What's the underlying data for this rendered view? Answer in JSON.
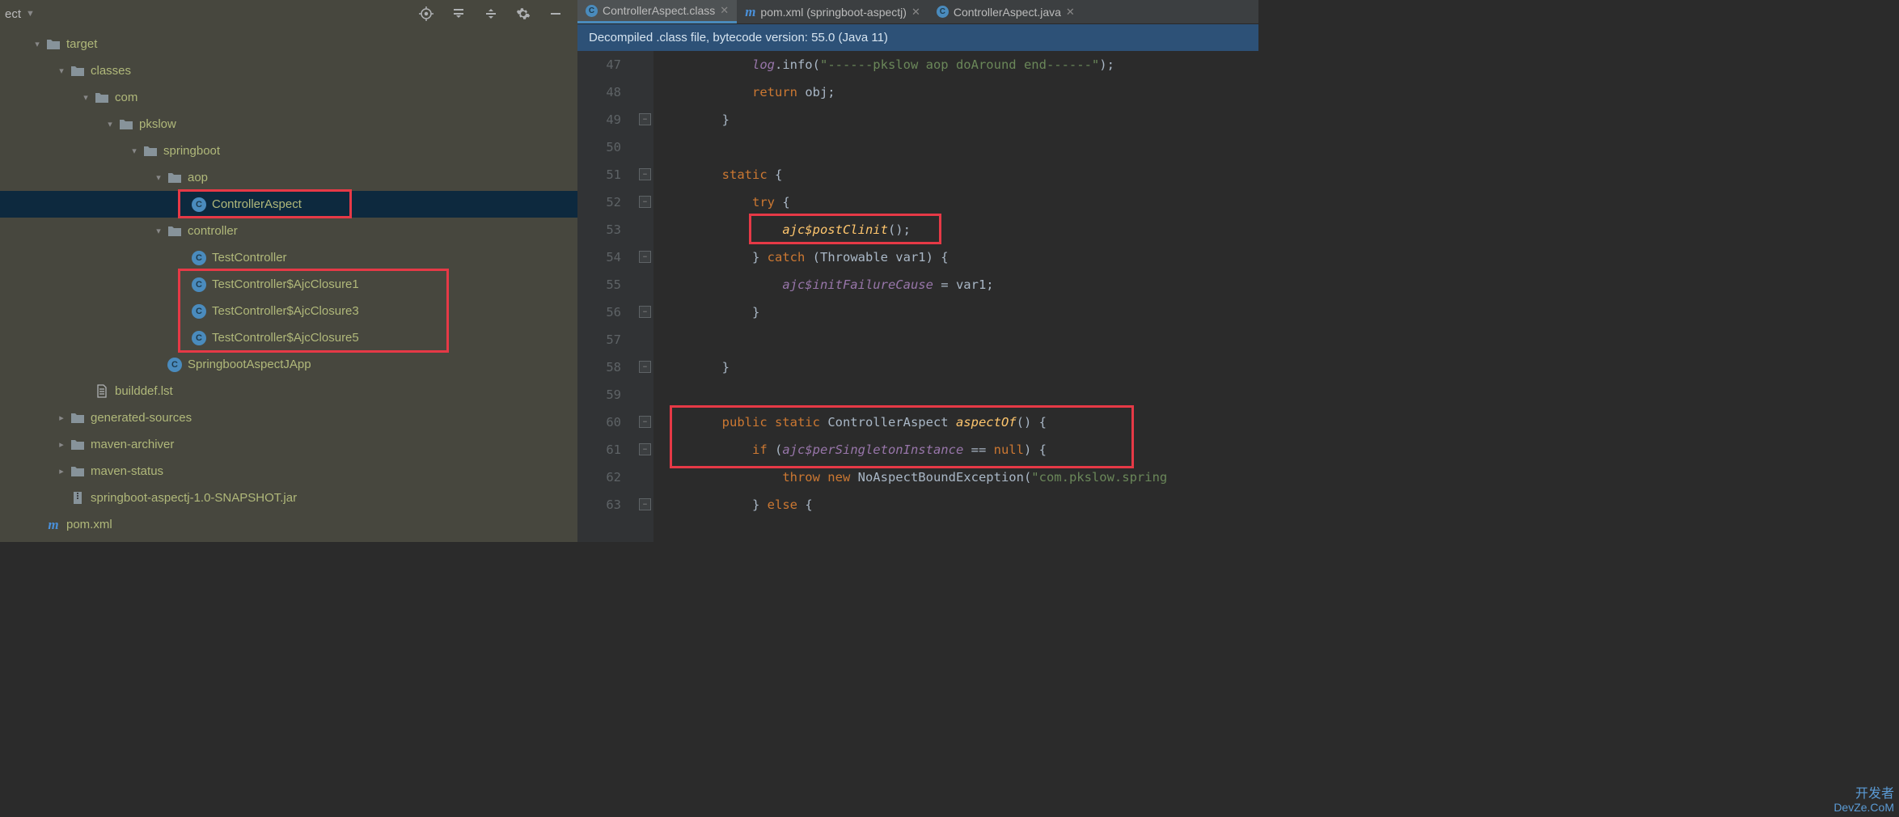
{
  "sidebar": {
    "title": "ect",
    "tree": [
      {
        "indent": 1,
        "arrow": "▾",
        "icon": "folder",
        "label": "target"
      },
      {
        "indent": 2,
        "arrow": "▾",
        "icon": "folder",
        "label": "classes"
      },
      {
        "indent": 3,
        "arrow": "▾",
        "icon": "folder",
        "label": "com"
      },
      {
        "indent": 4,
        "arrow": "▾",
        "icon": "folder",
        "label": "pkslow"
      },
      {
        "indent": 5,
        "arrow": "▾",
        "icon": "folder",
        "label": "springboot"
      },
      {
        "indent": 6,
        "arrow": "▾",
        "icon": "folder",
        "label": "aop"
      },
      {
        "indent": 7,
        "arrow": "",
        "icon": "class",
        "label": "ControllerAspect",
        "selected": true
      },
      {
        "indent": 6,
        "arrow": "▾",
        "icon": "folder",
        "label": "controller"
      },
      {
        "indent": 7,
        "arrow": "",
        "icon": "class",
        "label": "TestController"
      },
      {
        "indent": 7,
        "arrow": "",
        "icon": "class",
        "label": "TestController$AjcClosure1"
      },
      {
        "indent": 7,
        "arrow": "",
        "icon": "class",
        "label": "TestController$AjcClosure3"
      },
      {
        "indent": 7,
        "arrow": "",
        "icon": "class",
        "label": "TestController$AjcClosure5"
      },
      {
        "indent": 6,
        "arrow": "",
        "icon": "class",
        "label": "SpringbootAspectJApp"
      },
      {
        "indent": 3,
        "arrow": "",
        "icon": "file",
        "label": "builddef.lst"
      },
      {
        "indent": 2,
        "arrow": "▸",
        "icon": "folder",
        "label": "generated-sources"
      },
      {
        "indent": 2,
        "arrow": "▸",
        "icon": "folder",
        "label": "maven-archiver"
      },
      {
        "indent": 2,
        "arrow": "▸",
        "icon": "folder",
        "label": "maven-status"
      },
      {
        "indent": 2,
        "arrow": "",
        "icon": "archive",
        "label": "springboot-aspectj-1.0-SNAPSHOT.jar"
      },
      {
        "indent": 1,
        "arrow": "",
        "icon": "maven",
        "label": "pom.xml"
      }
    ]
  },
  "tabs": [
    {
      "icon": "class",
      "label": "ControllerAspect.class",
      "active": true
    },
    {
      "icon": "maven",
      "label": "pom.xml (springboot-aspectj)",
      "active": false
    },
    {
      "icon": "class",
      "label": "ControllerAspect.java",
      "active": false
    }
  ],
  "banner": "Decompiled .class file, bytecode version: 55.0 (Java 11)",
  "code": {
    "startLine": 47,
    "lines": [
      {
        "n": 47,
        "html": "            <span class='log'>log</span><span class='plain'>.info(</span><span class='str'>\"------pkslow aop doAround end------\"</span><span class='plain'>);</span>"
      },
      {
        "n": 48,
        "html": "            <span class='kw'>return</span><span class='plain'> obj;</span>"
      },
      {
        "n": 49,
        "html": "        <span class='plain'>}</span>",
        "fold": true
      },
      {
        "n": 50,
        "html": ""
      },
      {
        "n": 51,
        "html": "        <span class='kw'>static</span><span class='plain'> {</span>",
        "fold": true
      },
      {
        "n": 52,
        "html": "            <span class='kw'>try</span><span class='plain'> {</span>",
        "fold": true
      },
      {
        "n": 53,
        "html": "                <span class='fn'>ajc$postClinit</span><span class='plain'>();</span>"
      },
      {
        "n": 54,
        "html": "            <span class='plain'>} </span><span class='kw'>catch</span><span class='plain'> (Throwable var1) {</span>",
        "fold": true
      },
      {
        "n": 55,
        "html": "                <span class='field'>ajc$initFailureCause</span><span class='plain'> = var1;</span>"
      },
      {
        "n": 56,
        "html": "            <span class='plain'>}</span>",
        "fold": true
      },
      {
        "n": 57,
        "html": ""
      },
      {
        "n": 58,
        "html": "        <span class='plain'>}</span>",
        "fold": true
      },
      {
        "n": 59,
        "html": ""
      },
      {
        "n": 60,
        "html": "        <span class='kw'>public static</span><span class='plain'> ControllerAspect </span><span class='fn'>aspectOf</span><span class='plain'>() {</span>",
        "fold": true
      },
      {
        "n": 61,
        "html": "            <span class='kw'>if</span><span class='plain'> (</span><span class='field'>ajc$perSingletonInstance</span><span class='plain'> == </span><span class='kw'>null</span><span class='plain'>) {</span>",
        "fold": true
      },
      {
        "n": 62,
        "html": "                <span class='kw'>throw new</span><span class='plain'> NoAspectBoundException(</span><span class='str'>\"com.pkslow.spring</span>"
      },
      {
        "n": 63,
        "html": "            <span class='plain'>} </span><span class='kw'>else</span><span class='plain'> {</span>",
        "fold": true
      }
    ]
  },
  "watermark": {
    "line1": "开发者",
    "line2": "DevZe.CoM"
  }
}
